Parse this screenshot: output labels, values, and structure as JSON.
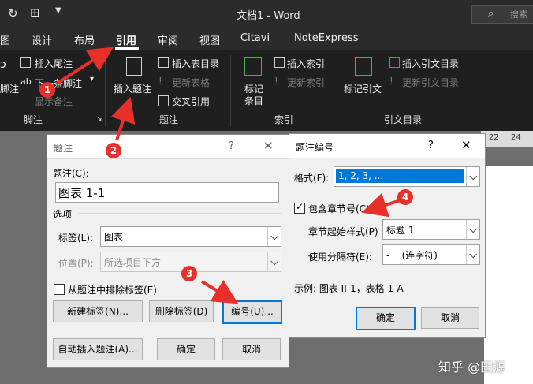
{
  "window": {
    "title": "文档1 - Word",
    "search_placeholder": "搜索"
  },
  "menu": {
    "tabs": [
      "图",
      "设计",
      "布局",
      "引用",
      "审阅",
      "视图",
      "Citavi",
      "NoteExpress"
    ],
    "active_tab": "引用"
  },
  "ribbon": {
    "footnote": {
      "items": [
        "插入尾注",
        "下一条脚注",
        "显示备注"
      ],
      "left_label": "脚注",
      "group_label": "脚注"
    },
    "caption": {
      "big_button": "插入题注",
      "items": [
        "插入表目录",
        "更新表格",
        "交叉引用"
      ],
      "group_label": "题注"
    },
    "index": {
      "big_button": [
        "标记",
        "条目"
      ],
      "items": [
        "插入索引",
        "更新索引"
      ],
      "group_label": "索引"
    },
    "toa": {
      "big_button": "标记引文",
      "items": [
        "插入引文目录",
        "更新引文目录"
      ],
      "group_label": "引文目录"
    }
  },
  "ruler": {
    "ticks": [
      "22",
      "24"
    ]
  },
  "caption_dialog": {
    "title": "题注",
    "caption_label": "题注(C):",
    "caption_value": "图表 1-1",
    "options_label": "选项",
    "label_label": "标签(L):",
    "label_value": "图表",
    "position_label": "位置(P):",
    "position_value": "所选项目下方",
    "exclude_label": "从题注中排除标签(E)",
    "btn_new_label": "新建标签(N)...",
    "btn_delete_label": "删除标签(D)",
    "btn_numbering": "编号(U)...",
    "btn_autocaption": "自动插入题注(A)...",
    "btn_ok": "确定",
    "btn_cancel": "取消"
  },
  "numbering_dialog": {
    "title": "题注编号",
    "format_label": "格式(F):",
    "format_value": "1, 2, 3, ...",
    "include_chapter_label": "包含章节号(C)",
    "include_chapter_checked": true,
    "chapter_style_label": "章节起始样式(P)",
    "chapter_style_value": "标题 1",
    "separator_label": "使用分隔符(E):",
    "separator_value": "-    (连字符)",
    "example_text": "示例: 图表 II-1，表格 1-A",
    "btn_ok": "确定",
    "btn_cancel": "取消"
  },
  "annotations": [
    "1",
    "2",
    "3",
    "4"
  ],
  "watermark": "知乎 @田源",
  "colors": {
    "titlebar": "#2b2b2b",
    "ribbon": "#1f1f1f",
    "annotation_red": "#e8302b",
    "selection_blue": "#0078d7"
  }
}
